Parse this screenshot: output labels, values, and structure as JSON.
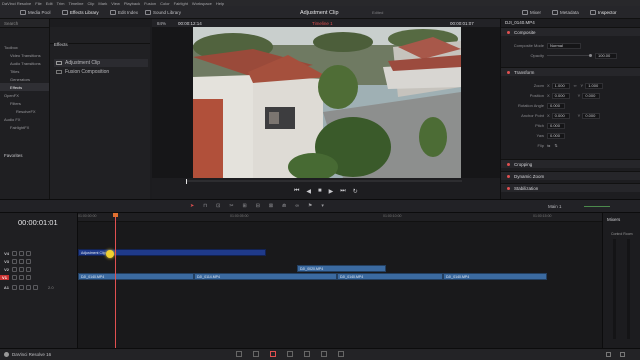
{
  "menu": [
    "DaVinci Resolve",
    "File",
    "Edit",
    "Trim",
    "Timeline",
    "Clip",
    "Mark",
    "View",
    "Playback",
    "Fusion",
    "Color",
    "Fairlight",
    "Workspace",
    "Help"
  ],
  "toolbar": {
    "media_pool": "Media Pool",
    "effects_library": "Effects Library",
    "edit_index": "Edit Index",
    "sound_library": "Sound Library",
    "project_title": "Adjustment Clip",
    "project_status": "Edited",
    "mixer": "Mixer",
    "metadata": "Metadata",
    "inspector": "Inspector"
  },
  "left": {
    "search": "Search",
    "items": [
      {
        "label": "Toolbox",
        "level": 0
      },
      {
        "label": "Video Transitions",
        "level": 1
      },
      {
        "label": "Audio Transitions",
        "level": 1
      },
      {
        "label": "Titles",
        "level": 1
      },
      {
        "label": "Generators",
        "level": 1
      },
      {
        "label": "Effects",
        "level": 1,
        "selected": true
      },
      {
        "label": "OpenFX",
        "level": 0
      },
      {
        "label": "Filters",
        "level": 1
      },
      {
        "label": "ResolveFX",
        "level": 2
      },
      {
        "label": "Audio FX",
        "level": 0
      },
      {
        "label": "FairlightFX",
        "level": 1
      }
    ],
    "favorites": "Favorites"
  },
  "effects_panel": {
    "header": "Effects",
    "items": [
      "Adjustment Clip",
      "Fusion Composition"
    ]
  },
  "viewer": {
    "zoom": "84%",
    "timecode_left": "00:00:12:14",
    "timeline_name": "Timeline 1",
    "timecode_right": "00:00:01:07",
    "clip_name": "DJI_0140.MP4"
  },
  "inspector": {
    "composite": "Composite",
    "composite_mode_label": "Composite Mode",
    "composite_mode": "Normal",
    "opacity_label": "Opacity",
    "opacity": "100.00",
    "transform": "Transform",
    "zoom_label": "Zoom",
    "zoom_x": "1.000",
    "zoom_y": "1.000",
    "position_label": "Position",
    "pos_x": "0.000",
    "pos_y": "0.000",
    "rotation_label": "Rotation Angle",
    "rotation": "0.000",
    "anchor_label": "Anchor Point",
    "anchor_x": "0.000",
    "anchor_y": "0.000",
    "pitch_label": "Pitch",
    "pitch": "0.000",
    "yaw_label": "Yaw",
    "yaw": "0.000",
    "flip_label": "Flip",
    "cropping": "Cropping",
    "dynamic_zoom": "Dynamic Zoom",
    "stabilization": "Stabilization"
  },
  "timeline": {
    "timecode": "00:00:01:01",
    "main_track": "Main 1",
    "ruler": [
      "01:00:00:00",
      "01:00:05:00",
      "01:00:10:00",
      "01:00:15:00"
    ],
    "tracks": [
      "V4",
      "V3",
      "V2",
      "V1",
      "A1"
    ],
    "a1_level": "2.0",
    "clips": {
      "adjustment": "Adjustment Clip",
      "v2": "DJI_0020.MP4",
      "v1a": "DJI_0140.MP4",
      "v1b": "DJI_0114.MP4",
      "v1c": "DJI_0140.MP4",
      "v1d": "DJI_0140.MP4"
    }
  },
  "mixer": {
    "title": "Mixers",
    "control_room": "Control Room"
  },
  "status": {
    "app": "DaVinci Resolve 16"
  }
}
